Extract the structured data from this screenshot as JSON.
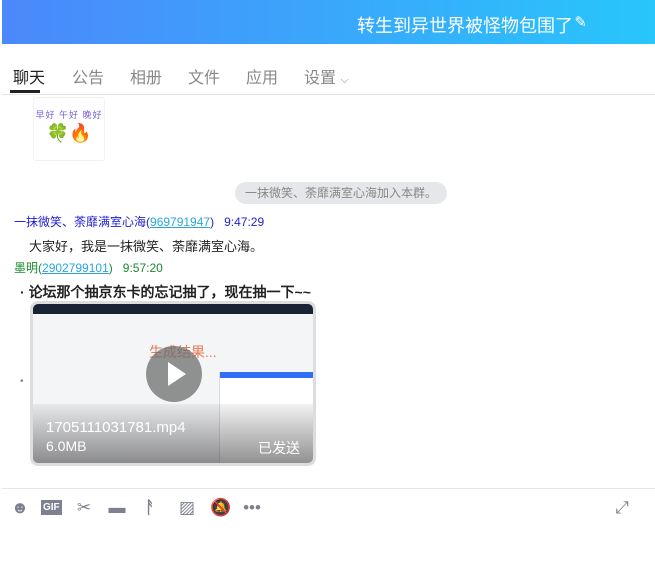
{
  "header": {
    "title": "转生到异世界被怪物包围了",
    "edit_icon": "pencil-icon"
  },
  "tabs": [
    {
      "label": "聊天"
    },
    {
      "label": "公告"
    },
    {
      "label": "相册"
    },
    {
      "label": "文件"
    },
    {
      "label": "应用"
    },
    {
      "label": "设置"
    }
  ],
  "sticker": {
    "text": "早好 午好 晚好",
    "emoji": "🍀🔥"
  },
  "notice": "一抹微笑、荼靡满室心海加入本群。",
  "messages": [
    {
      "name": "一抹微笑、荼靡满室心海",
      "id": "969791947",
      "time": "9:47:29",
      "text": "大家好，我是一抹微笑、荼靡满室心海。",
      "color": "#1f1fd0"
    },
    {
      "name": "墨明",
      "id": "2902799101",
      "time": "9:57:20",
      "text": "论坛那个抽京东卡的忘记抽了，现在抽一下~~",
      "color": "#1a8a2e"
    }
  ],
  "video": {
    "filename": "1705111031781.mp4",
    "size": "6.0MB",
    "status": "已发送",
    "preview_text": "生成结果..."
  },
  "toolbar": [
    "emoji-icon",
    "gif-icon",
    "scissors-icon",
    "folder-icon",
    "shake-icon",
    "image-icon",
    "bell-off-icon",
    "more-icon",
    "expand-icon"
  ]
}
